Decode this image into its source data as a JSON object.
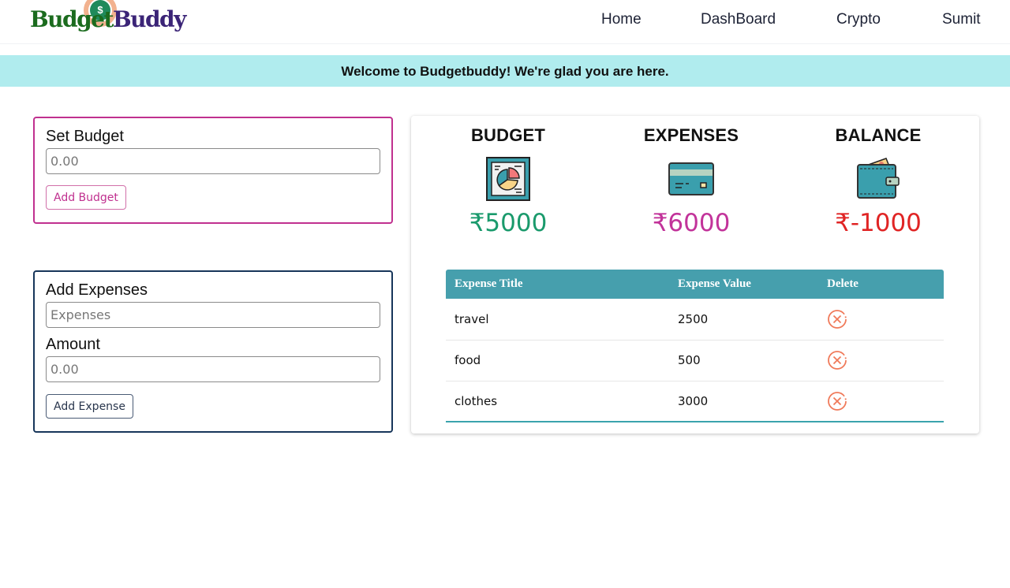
{
  "brand": {
    "part1": "Budget",
    "part2": "Buddy",
    "coin_symbol": "$"
  },
  "nav": {
    "items": [
      {
        "label": "Home"
      },
      {
        "label": "DashBoard"
      },
      {
        "label": "Crypto"
      },
      {
        "label": "Sumit"
      }
    ]
  },
  "banner": {
    "text": "Welcome to Budgetbuddy! We're glad you are here."
  },
  "budget_form": {
    "label": "Set Budget",
    "input_placeholder": "0.00",
    "button_label": "Add Budget"
  },
  "expense_form": {
    "title_label": "Add Expenses",
    "title_placeholder": "Expenses",
    "amount_label": "Amount",
    "amount_placeholder": "0.00",
    "button_label": "Add Expense"
  },
  "summary": {
    "budget": {
      "title": "BUDGET",
      "icon": "pie-chart-report-icon",
      "value": "₹5000",
      "color": "#1a9a6c"
    },
    "expenses": {
      "title": "EXPENSES",
      "icon": "credit-card-icon",
      "value": "₹6000",
      "color": "#c2339a"
    },
    "balance": {
      "title": "BALANCE",
      "icon": "wallet-icon",
      "value": "₹-1000",
      "color": "#e02424"
    }
  },
  "expense_table": {
    "headers": [
      "Expense Title",
      "Expense Value",
      "Delete"
    ],
    "rows": [
      {
        "title": "travel",
        "value": "2500",
        "action_icon": "delete-circle-x-icon"
      },
      {
        "title": "food",
        "value": "500",
        "action_icon": "delete-circle-x-icon"
      },
      {
        "title": "clothes",
        "value": "3000",
        "action_icon": "delete-circle-x-icon"
      }
    ]
  }
}
